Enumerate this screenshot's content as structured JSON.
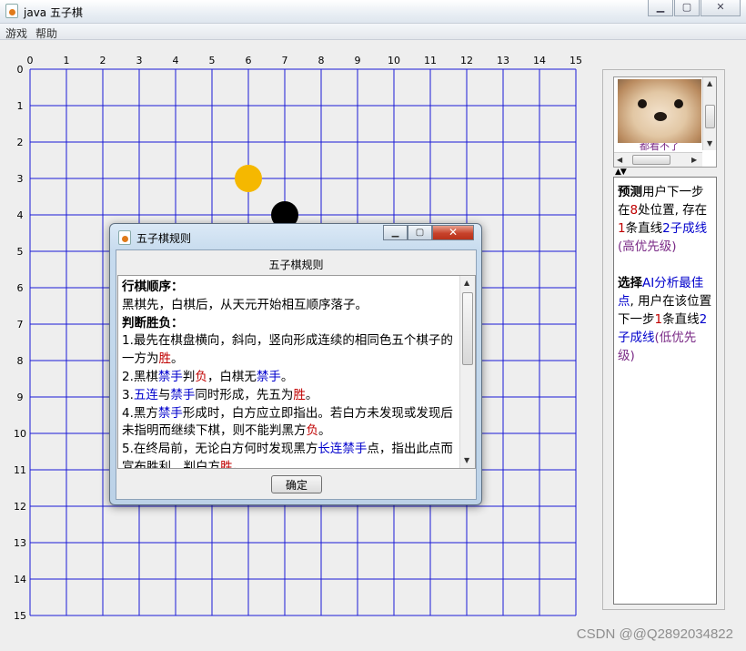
{
  "window": {
    "title": "java 五子棋"
  },
  "menu": {
    "items": [
      "游戏",
      "帮助"
    ]
  },
  "board": {
    "size": 15,
    "line_color": "#1a1ad6",
    "col_labels": [
      "0",
      "1",
      "2",
      "3",
      "4",
      "5",
      "6",
      "7",
      "8",
      "9",
      "10",
      "11",
      "12",
      "13",
      "14",
      "15"
    ],
    "row_labels": [
      "0",
      "1",
      "2",
      "3",
      "4",
      "5",
      "6",
      "7",
      "8",
      "9",
      "10",
      "11",
      "12",
      "13",
      "14",
      "15"
    ],
    "stones": [
      {
        "col": 6,
        "row": 3,
        "color": "#f5b800",
        "kind": "hint"
      },
      {
        "col": 7,
        "row": 4,
        "color": "#000000",
        "kind": "black"
      }
    ]
  },
  "side": {
    "image_caption": "都看不了",
    "hint_paragraphs": [
      [
        {
          "t": "预测",
          "c": "b"
        },
        {
          "t": "用户下一步在",
          "c": ""
        },
        {
          "t": "8",
          "c": "red"
        },
        {
          "t": "处位置, 存在",
          "c": ""
        },
        {
          "t": "1",
          "c": "red"
        },
        {
          "t": "条直线",
          "c": ""
        },
        {
          "t": "2子成线",
          "c": "blue"
        },
        {
          "t": "(高优先级)",
          "c": "purple"
        }
      ],
      [
        {
          "t": "选择",
          "c": "b"
        },
        {
          "t": "AI分析最佳点",
          "c": "blue"
        },
        {
          "t": ", 用户在该位置下一步",
          "c": ""
        },
        {
          "t": "1",
          "c": "red"
        },
        {
          "t": "条直线",
          "c": ""
        },
        {
          "t": "2子成线",
          "c": "blue"
        },
        {
          "t": "(低优先级)",
          "c": "purple"
        }
      ]
    ]
  },
  "dialog": {
    "title": "五子棋规则",
    "heading": "五子棋规则",
    "ok_label": "确定",
    "rules": [
      [
        {
          "t": "行棋顺序：",
          "c": "b"
        }
      ],
      [
        {
          "t": "黑棋先，白棋后，从天元开始相互顺序落子。",
          "c": ""
        }
      ],
      [
        {
          "t": "判断胜负：",
          "c": "b"
        }
      ],
      [
        {
          "t": "1.最先在棋盘横向，斜向，竖向形成连续的相同色五个棋子的一方为",
          "c": ""
        },
        {
          "t": "胜",
          "c": "red"
        },
        {
          "t": "。",
          "c": ""
        }
      ],
      [
        {
          "t": "2.黑棋",
          "c": ""
        },
        {
          "t": "禁手",
          "c": "blue"
        },
        {
          "t": "判",
          "c": ""
        },
        {
          "t": "负",
          "c": "red"
        },
        {
          "t": "，白棋无",
          "c": ""
        },
        {
          "t": "禁手",
          "c": "blue"
        },
        {
          "t": "。",
          "c": ""
        }
      ],
      [
        {
          "t": "3.",
          "c": ""
        },
        {
          "t": "五连",
          "c": "blue"
        },
        {
          "t": "与",
          "c": ""
        },
        {
          "t": "禁手",
          "c": "blue"
        },
        {
          "t": "同时形成，先五为",
          "c": ""
        },
        {
          "t": "胜",
          "c": "red"
        },
        {
          "t": "。",
          "c": ""
        }
      ],
      [
        {
          "t": "4.黑方",
          "c": ""
        },
        {
          "t": "禁手",
          "c": "blue"
        },
        {
          "t": "形成时，白方应立即指出。若白方未发现或发现后未指明而继续下棋，则不能判黑方",
          "c": ""
        },
        {
          "t": "负",
          "c": "red"
        },
        {
          "t": "。",
          "c": ""
        }
      ],
      [
        {
          "t": "5.在终局前，无论白方何时发现黑方",
          "c": ""
        },
        {
          "t": "长连禁手",
          "c": "blue"
        },
        {
          "t": "点，指出此点而宣布胜利，判白方",
          "c": ""
        },
        {
          "t": "胜",
          "c": "red"
        },
        {
          "t": "。",
          "c": ""
        }
      ]
    ]
  },
  "watermark": "CSDN @@Q2892034822"
}
